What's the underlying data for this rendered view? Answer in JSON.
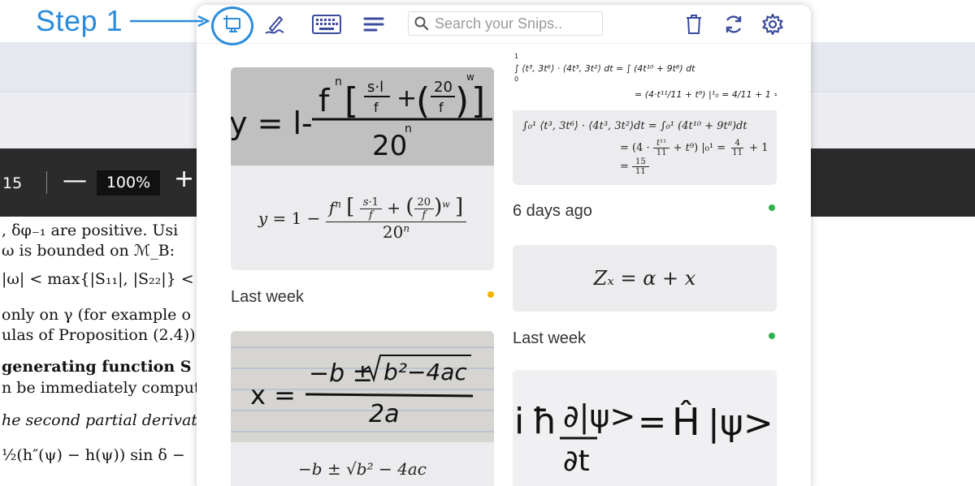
{
  "annotation": {
    "step_label": "Step 1"
  },
  "background_pdf": {
    "page_number": "15",
    "zoom_level": "100%",
    "minus": "—",
    "plus": "+",
    "lines": [
      ", δφ₋₁ are positive.  Usi",
      "  ω is bounded on ℳ_B:",
      " |ω| < max{|S₁₁|, |S₂₂|} <",
      "only on γ (for example o",
      "ulas of Proposition (2.4)).",
      " generating function S",
      "n be immediately comput",
      "he second partial derivati",
      " ½(h″(ψ) − h(ψ)) sin δ −"
    ]
  },
  "toolbar": {
    "search_placeholder": "Search your Snips.."
  },
  "snips": {
    "left": [
      {
        "rendered_formula": "y = 1 − fⁿ[(s·1)/f + ((20)/f)ʷ] / 20ⁿ",
        "render_parts": {
          "lhs": "y = 1 −",
          "num": "fⁿ [ s·1/f + (20/f)ʷ ]",
          "den": "20ⁿ"
        },
        "time": "Last week",
        "status_color": "#f0b400"
      },
      {
        "rendered_formula": "x = (−b ± √(b² − 4ac)) / 2a",
        "render_parts": {
          "partial": "−b ± √b² − 4ac"
        }
      }
    ],
    "right": [
      {
        "time": "6 days ago",
        "status_color": "#2fb24b"
      },
      {
        "rendered_formula": "Zₓ = α + x",
        "time": "Last week",
        "status_color": "#2fb24b"
      },
      {
        "rendered_formula": "iħ ∂|ψ>/∂t = Ĥ|ψ>"
      }
    ]
  },
  "colors": {
    "accent": "#2a8cdc",
    "icon": "#3b4a9c"
  }
}
